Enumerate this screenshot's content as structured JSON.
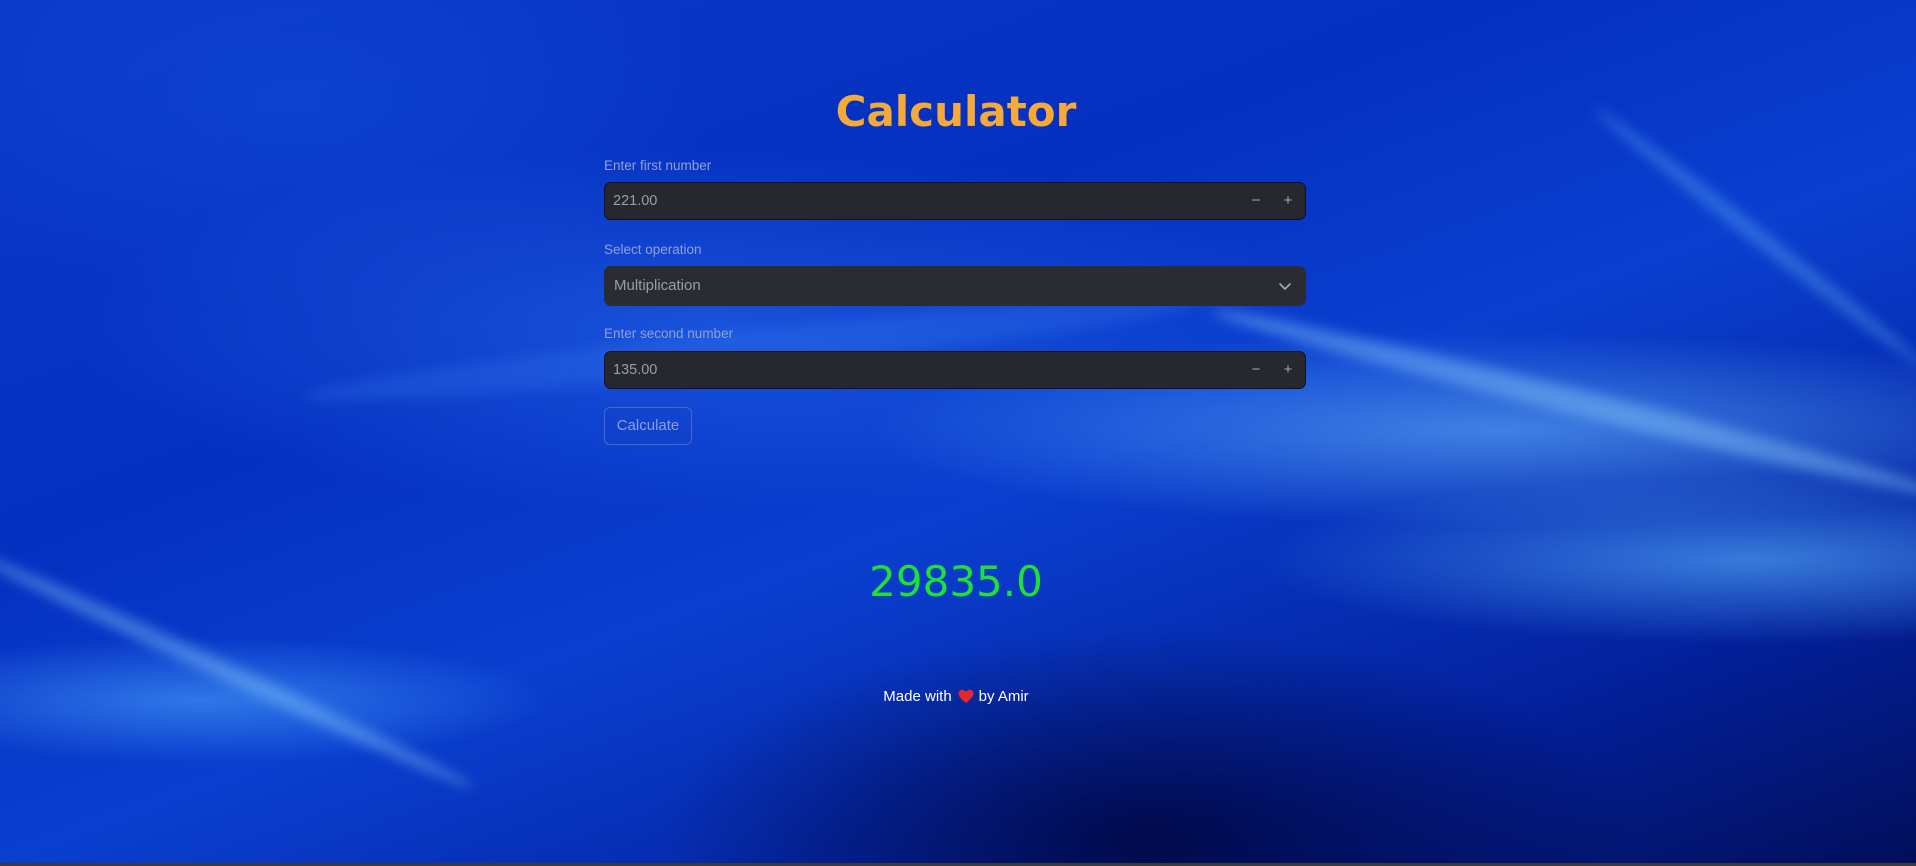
{
  "app": {
    "title": "Calculator"
  },
  "first_number": {
    "label": "Enter first number",
    "value": "221.00",
    "decrement": "−",
    "increment": "+"
  },
  "operation": {
    "label": "Select operation",
    "selected": "Multiplication"
  },
  "second_number": {
    "label": "Enter second number",
    "value": "135.00",
    "decrement": "−",
    "increment": "+"
  },
  "calculate_button": {
    "label": "Calculate"
  },
  "result": {
    "value": "29835.0"
  },
  "footer": {
    "prefix": "Made with",
    "icon": "heart-icon",
    "suffix": "by Amir"
  },
  "colors": {
    "title": "#f5a93a",
    "result": "#1fe035",
    "input_bg": "#26272f",
    "background": "#0326b0"
  }
}
